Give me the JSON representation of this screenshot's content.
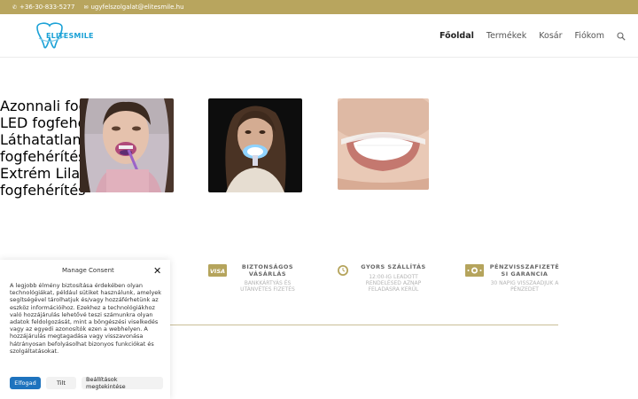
{
  "topbar": {
    "phone": "+36-30-833-5277",
    "email": "ugyfelszolgalat@elitesmile.hu",
    "phone_icon": "phone-icon",
    "email_icon": "envelope-icon"
  },
  "header": {
    "logo_text": "ELITESMILE",
    "nav": [
      "Főoldal",
      "Termékek",
      "Kosár",
      "Fiókom"
    ],
    "search_icon": "search-icon"
  },
  "products": [
    {
      "title_line1": "Azonnali fogfehérítés",
      "title_line2": ""
    },
    {
      "title_line1": "LED fogfehérítés",
      "title_line2": ""
    },
    {
      "title_line1": "Láthatatlan",
      "title_line2": "fogfehérítés"
    },
    {
      "title_line1": "Extrém Lila",
      "title_line2": "fogfehérítés"
    }
  ],
  "features": [
    {
      "icon": "visa-card-icon",
      "icon_text": "VISA",
      "line1": "BIZTONSÁGOS",
      "line2": "VÁSÁRLÁS",
      "sub1": "BANKKÁRTYÁS ÉS",
      "sub2": "UTÁNVÉTES FIZETÉS",
      "sub3": ""
    },
    {
      "icon": "clock-icon",
      "line1": "GYORS SZÁLLÍTÁS",
      "line2": "",
      "sub1": "12:00-IG LEADOTT",
      "sub2": "RENDELÉSED AZNAP",
      "sub3": "FELADÁSRA KERÜL"
    },
    {
      "icon": "cash-icon",
      "line1": "PÉNZVISSZAFIZETÉ",
      "line2": "SI GARANCIA",
      "sub1": "30 NAPIG VISSZAADJUK A",
      "sub2": "PÉNZEDET",
      "sub3": ""
    }
  ],
  "consent": {
    "heading": "Manage Consent",
    "body": "A legjobb élmény biztosítása érdekében olyan technológiákat, például sütiket használunk, amelyek segítségével tárolhatjuk és/vagy hozzáférhetünk az eszköz információihoz. Ezekhez a technológiákhoz való hozzájárulás lehetővé teszi számunkra olyan adatok feldolgozását, mint a böngészési viselkedés vagy az egyedi azonosítók ezen a webhelyen. A hozzájárulás megtagadása vagy visszavonása hátrányosan befolyásolhat bizonyos funkciókat és szolgáltatásokat.",
    "accept": "Elfogad",
    "deny": "Tilt",
    "settings": "Beállítások megtekintése",
    "close_icon": "close-icon"
  },
  "colors": {
    "topbar": "#b8a55e",
    "accent_link": "#1a1aa6",
    "primary_button": "#1e73be"
  }
}
